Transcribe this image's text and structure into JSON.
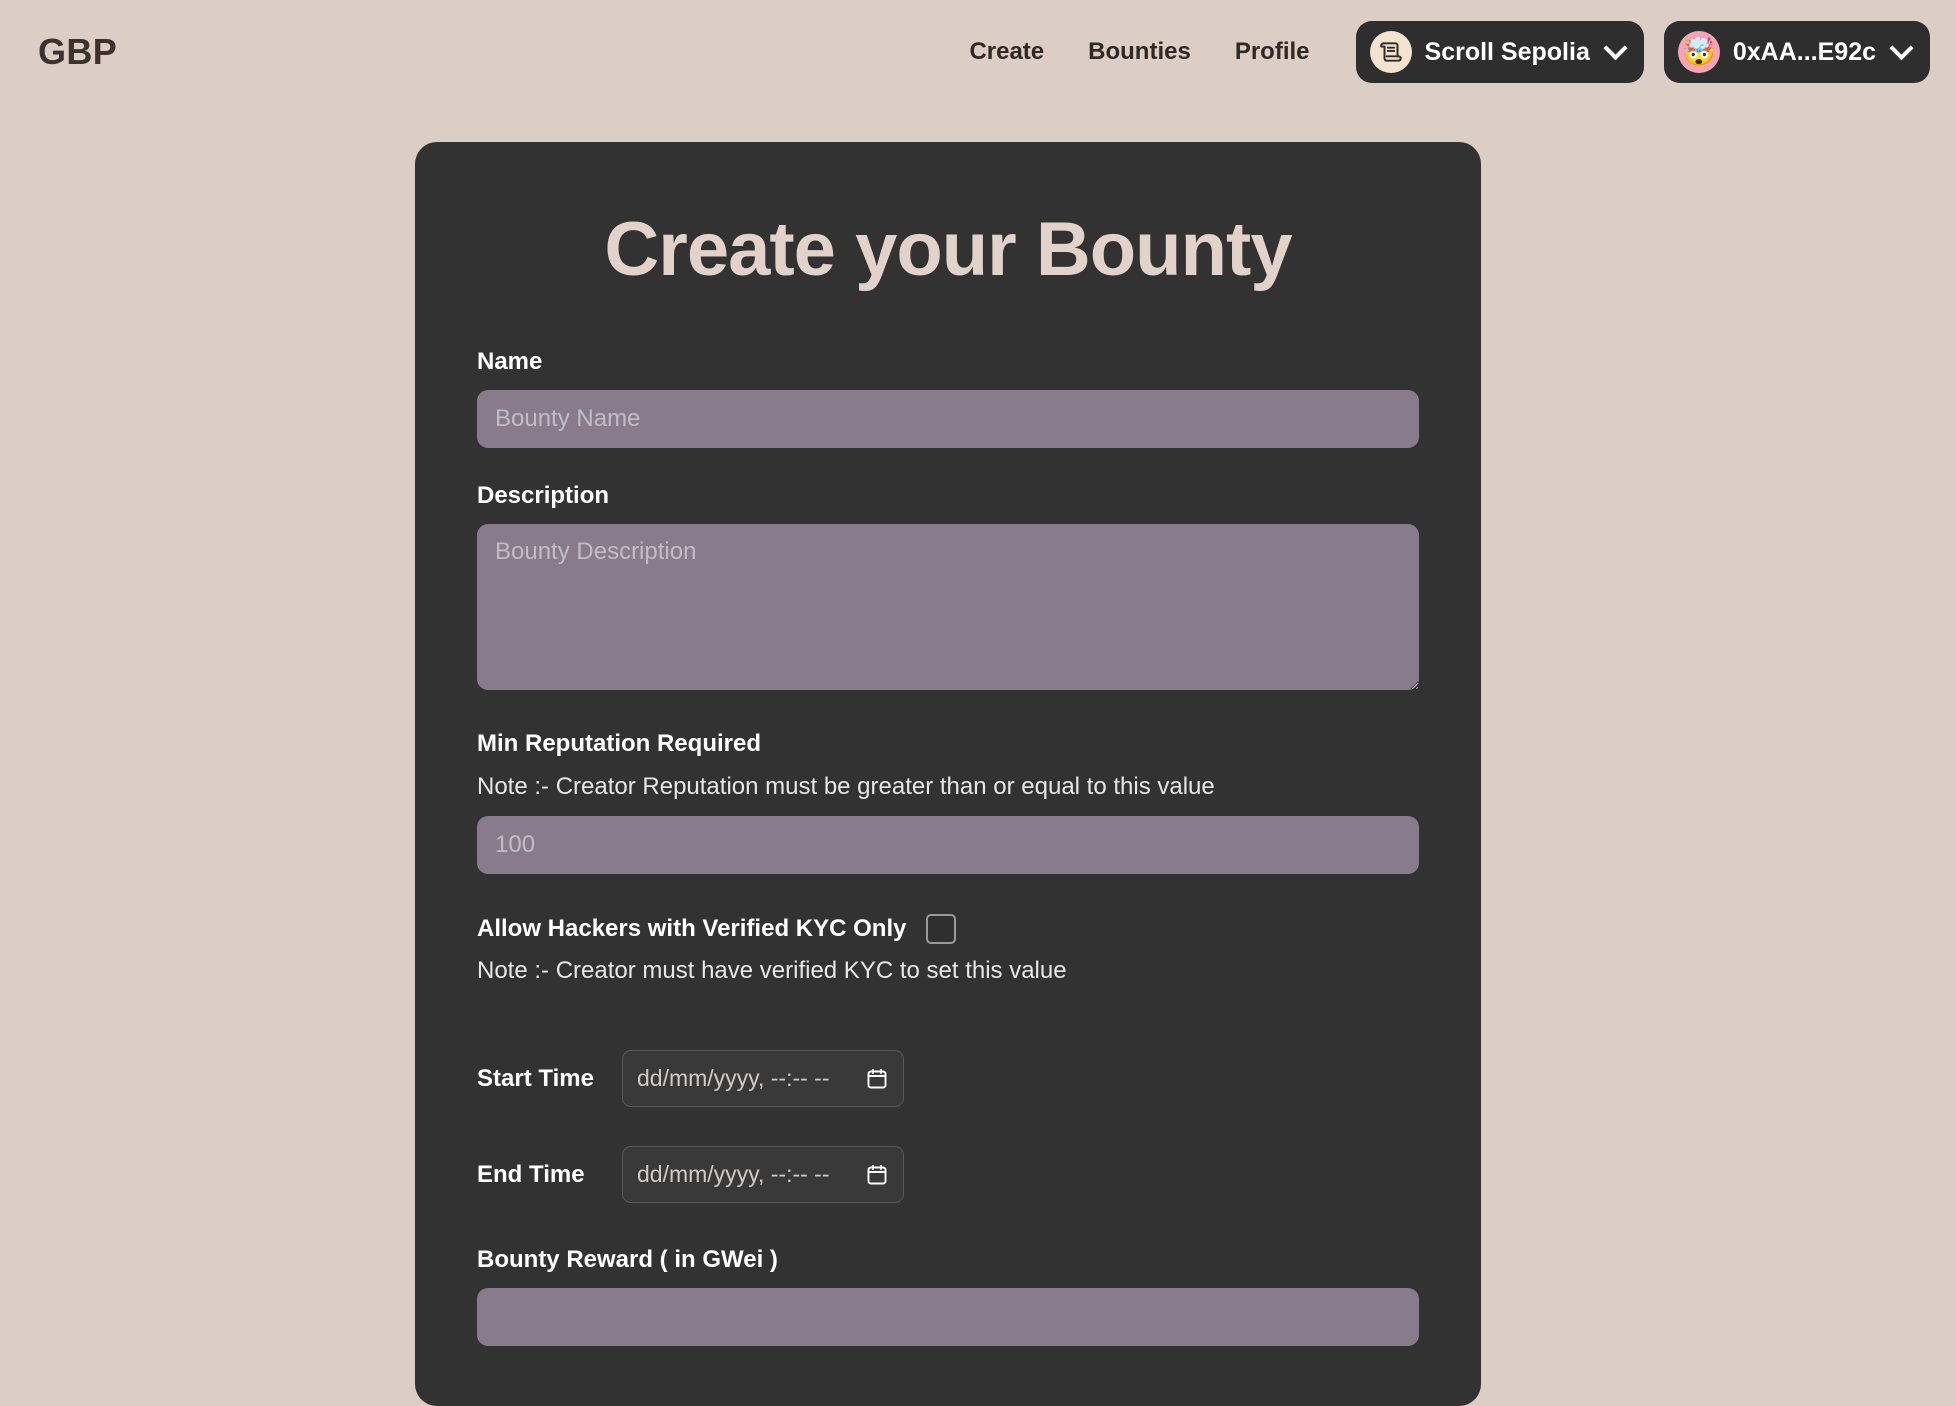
{
  "brand": {
    "name": "GBP"
  },
  "nav": {
    "links": [
      {
        "label": "Create"
      },
      {
        "label": "Bounties"
      },
      {
        "label": "Profile"
      }
    ],
    "network_chip": {
      "label": "Scroll Sepolia",
      "icon": "scroll-icon"
    },
    "wallet_chip": {
      "label": "0xAA...E92c",
      "avatar_emoji": "🤯"
    }
  },
  "card": {
    "title": "Create your Bounty",
    "name_field": {
      "label": "Name",
      "placeholder": "Bounty Name",
      "value": ""
    },
    "description_field": {
      "label": "Description",
      "placeholder": "Bounty Description",
      "value": ""
    },
    "reputation_field": {
      "label": "Min Reputation Required",
      "note": "Note :- Creator Reputation must be greater than or equal to this value",
      "placeholder": "100",
      "value": ""
    },
    "kyc_field": {
      "label": "Allow Hackers with Verified KYC Only",
      "note": "Note :- Creator must have verified KYC to set this value",
      "checked": false
    },
    "start_time_field": {
      "label": "Start Time",
      "placeholder": "dd/mm/yyyy, --:-- --",
      "value": ""
    },
    "end_time_field": {
      "label": "End Time",
      "placeholder": "dd/mm/yyyy, --:-- --",
      "value": ""
    },
    "reward_field": {
      "label": "Bounty Reward ( in GWei )",
      "placeholder": "",
      "value": ""
    }
  },
  "colors": {
    "page_background": "#dccdc5",
    "card_background": "#323232",
    "title": "#e2d2c9",
    "input_background": "#877b8c",
    "chip_background": "#2e2e2e",
    "wallet_avatar": "#f9a4b4",
    "network_avatar": "#f4e3cf"
  }
}
